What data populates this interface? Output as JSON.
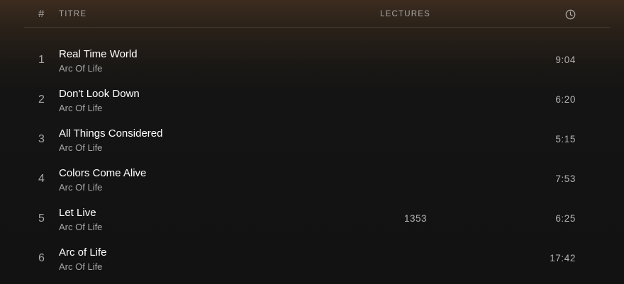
{
  "header": {
    "number_label": "#",
    "title_label": "TITRE",
    "plays_label": "LECTURES",
    "duration_icon": "clock-icon"
  },
  "tracks": [
    {
      "number": "1",
      "title": "Real Time World",
      "artist": "Arc Of Life",
      "plays": "",
      "duration": "9:04"
    },
    {
      "number": "2",
      "title": "Don't Look Down",
      "artist": "Arc Of Life",
      "plays": "",
      "duration": "6:20"
    },
    {
      "number": "3",
      "title": "All Things Considered",
      "artist": "Arc Of Life",
      "plays": "",
      "duration": "5:15"
    },
    {
      "number": "4",
      "title": "Colors Come Alive",
      "artist": "Arc Of Life",
      "plays": "",
      "duration": "7:53"
    },
    {
      "number": "5",
      "title": "Let Live",
      "artist": "Arc Of Life",
      "plays": "1353",
      "duration": "6:25"
    },
    {
      "number": "6",
      "title": "Arc of Life",
      "artist": "Arc Of Life",
      "plays": "",
      "duration": "17:42"
    }
  ],
  "colors": {
    "background_top": "#3c2c1f",
    "background_bottom": "#121212",
    "title_text": "#ffffff",
    "secondary_text": "#a7a7a7"
  }
}
